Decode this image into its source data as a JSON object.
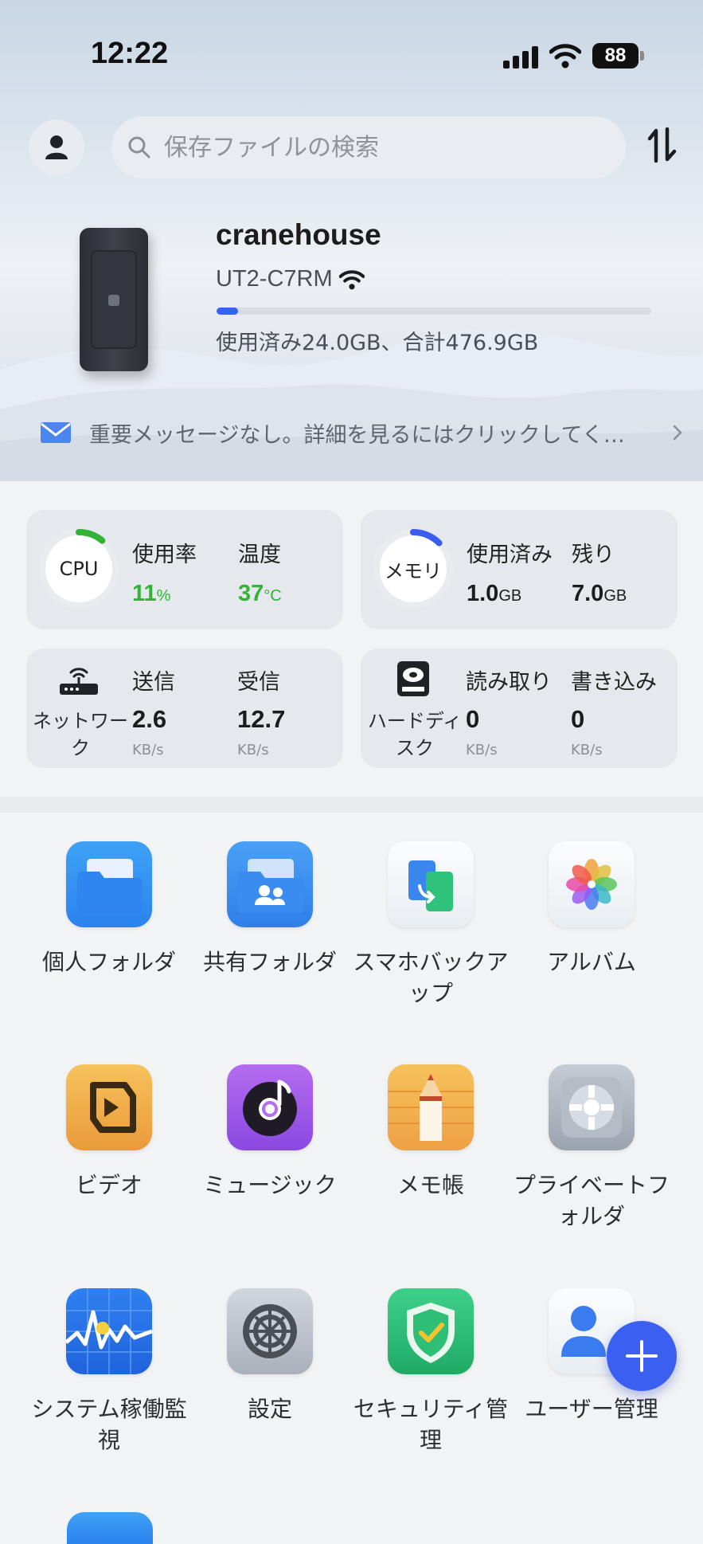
{
  "status_bar": {
    "time": "12:22",
    "battery": "88"
  },
  "header": {
    "search_placeholder": "保存ファイルの検索"
  },
  "device": {
    "name": "cranehouse",
    "model": "UT2-C7RM",
    "storage_used_fraction": 0.05,
    "usage_text": "使用済み24.0GB、合計476.9GB"
  },
  "message_bar": {
    "text": "重要メッセージなし。詳細を見るにはクリックしてく…"
  },
  "stats": {
    "cpu": {
      "label": "CPU",
      "usage_label": "使用率",
      "usage_value": "11",
      "usage_unit": "%",
      "temp_label": "温度",
      "temp_value": "37",
      "temp_unit": "°C",
      "ring_color": "#33b335"
    },
    "memory": {
      "label": "メモリ",
      "used_label": "使用済み",
      "used_value": "1.0",
      "used_unit": "GB",
      "free_label": "残り",
      "free_value": "7.0",
      "free_unit": "GB",
      "ring_color": "#3a5cf0"
    },
    "network": {
      "label": "ネットワーク",
      "send_label": "送信",
      "send_value": "2.6",
      "send_unit": "KB/s",
      "recv_label": "受信",
      "recv_value": "12.7",
      "recv_unit": "KB/s"
    },
    "disk": {
      "label": "ハードディスク",
      "read_label": "読み取り",
      "read_value": "0",
      "read_unit": "KB/s",
      "write_label": "書き込み",
      "write_value": "0",
      "write_unit": "KB/s"
    }
  },
  "apps": [
    {
      "label": "個人フォルダ",
      "icon": "personal-folder-icon"
    },
    {
      "label": "共有フォルダ",
      "icon": "shared-folder-icon"
    },
    {
      "label": "スマホバックアップ",
      "icon": "phone-backup-icon"
    },
    {
      "label": "アルバム",
      "icon": "album-icon"
    },
    {
      "label": "ビデオ",
      "icon": "video-icon"
    },
    {
      "label": "ミュージック",
      "icon": "music-icon"
    },
    {
      "label": "メモ帳",
      "icon": "notepad-icon"
    },
    {
      "label": "プライベートフォルダ",
      "icon": "private-folder-icon"
    },
    {
      "label": "システム稼働監視",
      "icon": "system-monitor-icon"
    },
    {
      "label": "設定",
      "icon": "settings-icon"
    },
    {
      "label": "セキュリティ管理",
      "icon": "security-icon"
    },
    {
      "label": "ユーザー管理",
      "icon": "user-management-icon"
    }
  ]
}
